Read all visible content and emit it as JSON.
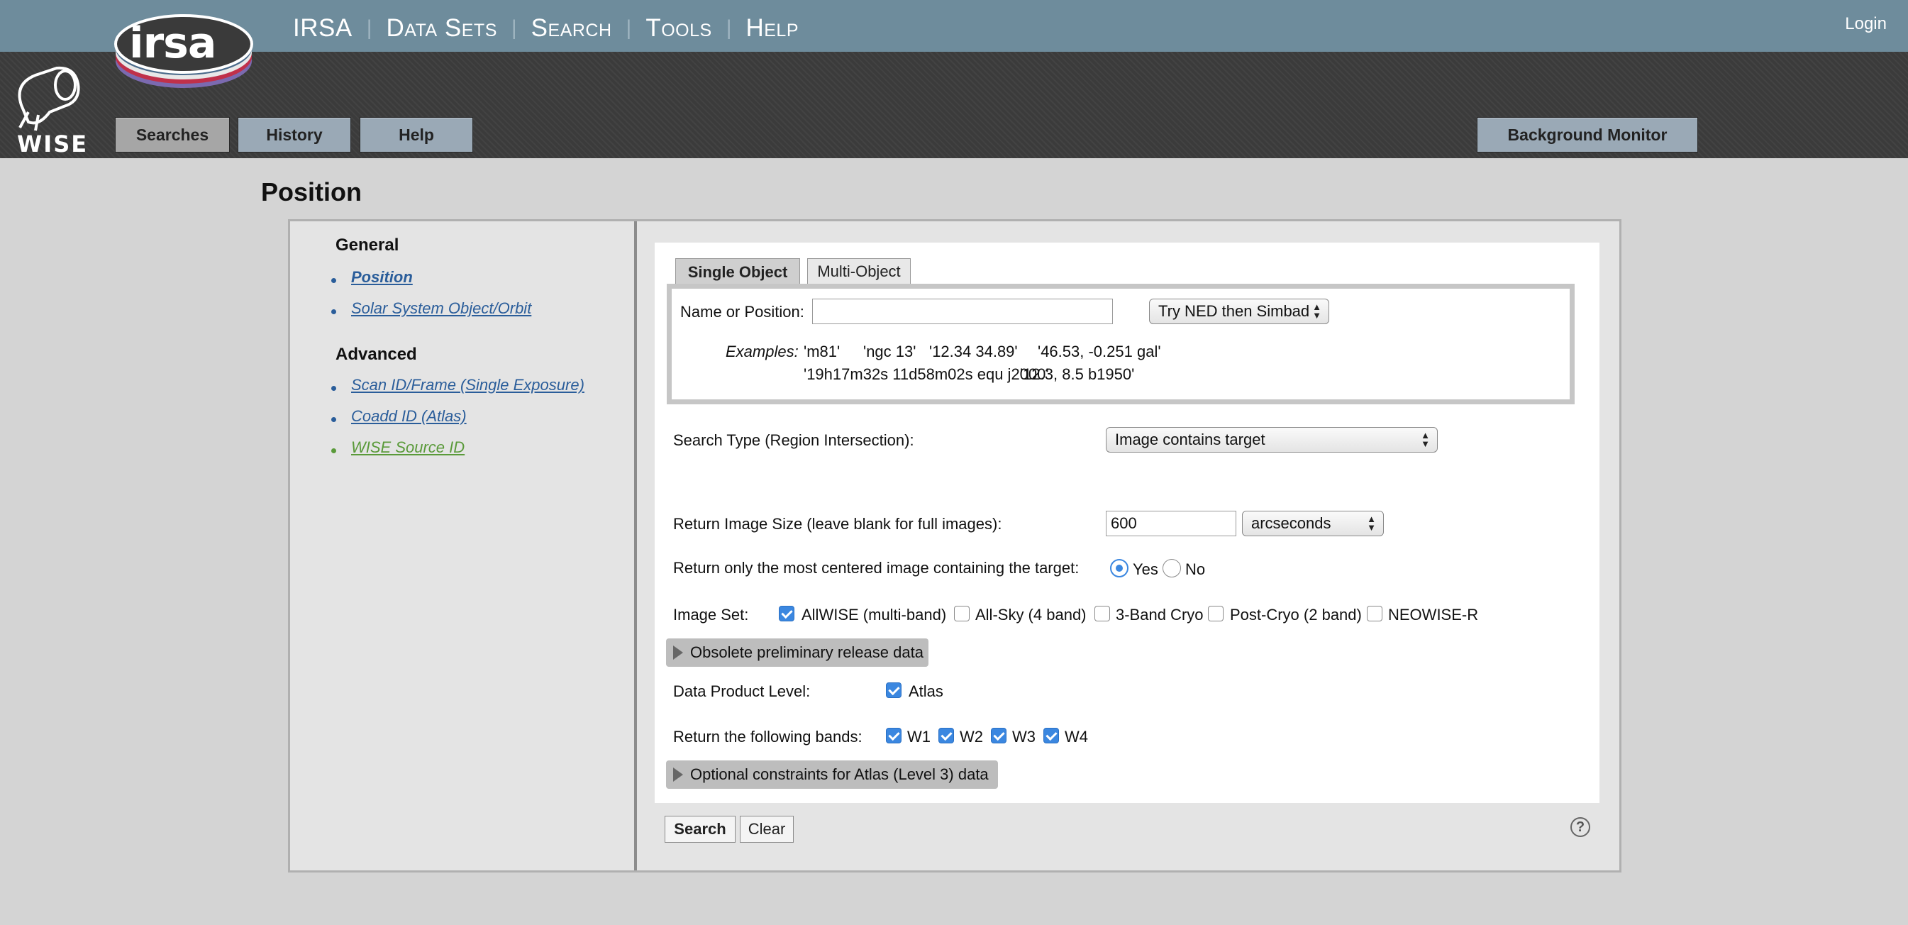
{
  "topnav": {
    "items": [
      "IRSA",
      "Data Sets",
      "Search",
      "Tools",
      "Help"
    ],
    "login": "Login"
  },
  "logos": {
    "irsa_text": "irsa",
    "wise_text": "WISE"
  },
  "header_buttons": {
    "searches": "Searches",
    "history": "History",
    "help": "Help",
    "background_monitor": "Background Monitor"
  },
  "page_title": "Position",
  "sidebar": {
    "general_heading": "General",
    "general_items": [
      "Position",
      "Solar System Object/Orbit"
    ],
    "advanced_heading": "Advanced",
    "advanced_items": [
      "Scan ID/Frame (Single Exposure)",
      "Coadd ID (Atlas)",
      "WISE Source ID"
    ]
  },
  "tabs": {
    "single": "Single Object",
    "multi": "Multi-Object"
  },
  "name_field": {
    "label": "Name or Position:",
    "value": "",
    "resolver": "Try NED then Simbad",
    "examples_label": "Examples:",
    "examples_line1": [
      "'m81'",
      "'ngc 13'",
      "'12.34 34.89'",
      "'46.53, -0.251 gal'"
    ],
    "examples_line2": [
      "'19h17m32s 11d58m02s equ j2000'",
      "'12.3, 8.5 b1950'"
    ]
  },
  "search_type": {
    "label": "Search Type (Region Intersection):",
    "value": "Image contains target"
  },
  "image_size": {
    "label": "Return Image Size (leave blank for full images):",
    "value": "600",
    "unit": "arcseconds"
  },
  "centered": {
    "label": "Return only the most centered image containing the target:",
    "yes": "Yes",
    "no": "No",
    "selected": "Yes"
  },
  "image_set": {
    "label": "Image Set:",
    "options": [
      {
        "label": "AllWISE (multi-band)",
        "checked": true
      },
      {
        "label": "All-Sky (4 band)",
        "checked": false
      },
      {
        "label": "3-Band Cryo",
        "checked": false
      },
      {
        "label": "Post-Cryo (2 band)",
        "checked": false
      },
      {
        "label": "NEOWISE-R",
        "checked": false
      }
    ]
  },
  "obsolete_section": "Obsolete preliminary release data",
  "product_level": {
    "label": "Data Product Level:",
    "option": "Atlas",
    "checked": true
  },
  "bands": {
    "label": "Return the following bands:",
    "options": [
      "W1",
      "W2",
      "W3",
      "W4"
    ]
  },
  "optional_section": "Optional constraints for Atlas (Level 3) data",
  "actions": {
    "search": "Search",
    "clear": "Clear",
    "help_icon": "?"
  },
  "colors": {
    "topbar": "#6e8c9c",
    "header": "#3b3b3b",
    "link": "#2a5d9a",
    "accent": "#3b87e0"
  }
}
